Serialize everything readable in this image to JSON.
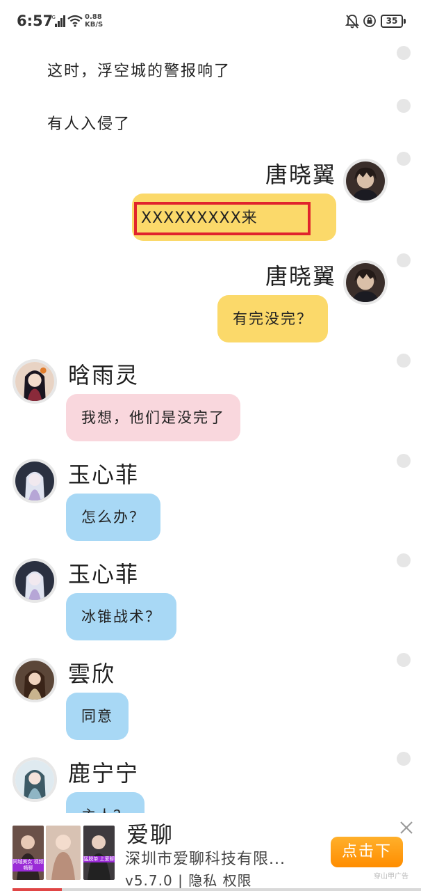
{
  "status_bar": {
    "time": "6:57",
    "network": "4G",
    "speed_value": "0.88",
    "speed_unit": "KB/S",
    "battery": "35"
  },
  "narration": [
    "这时，浮空城的警报响了",
    "有人入侵了"
  ],
  "messages": [
    {
      "sender": "唐晓翼",
      "side": "right",
      "text": "XXXXXXXXX来",
      "bubble_color": "#fbd96a",
      "highlighted": true
    },
    {
      "sender": "唐晓翼",
      "side": "right",
      "text": "有完没完？",
      "bubble_color": "#fbd96a"
    },
    {
      "sender": "晗雨灵",
      "side": "left",
      "text": "我想，他们是没完了",
      "bubble_color": "#f9d7dd"
    },
    {
      "sender": "玉心菲",
      "side": "left",
      "text": "怎么办？",
      "bubble_color": "#a8d8f5"
    },
    {
      "sender": "玉心菲",
      "side": "left",
      "text": "冰锥战术？",
      "bubble_color": "#a8d8f5"
    },
    {
      "sender": "雲欣",
      "side": "left",
      "text": "同意",
      "bubble_color": "#a8d8f5"
    },
    {
      "sender": "鹿宁宁",
      "side": "left",
      "text": "主人？",
      "bubble_color": "#a8d8f5"
    }
  ],
  "ad": {
    "app_name": "爱聊",
    "company": "深圳市爱聊科技有限...",
    "version": "v5.7.0",
    "separator": "|",
    "privacy": "隐私",
    "permissions": "权限",
    "cta": "点击下",
    "source": "穿山甲广告",
    "thumb1_text": "同城美女 视频畅聊",
    "thumb3_text": "猛脱单 上爱聊",
    "progress": 0.12,
    "accent_color": "#ff8d00"
  },
  "colors": {
    "pink_bubble": "#f9d7dd",
    "blue_bubble": "#a8d8f5",
    "yellow_bubble": "#fbd96a",
    "highlight_box": "#e0232d"
  }
}
